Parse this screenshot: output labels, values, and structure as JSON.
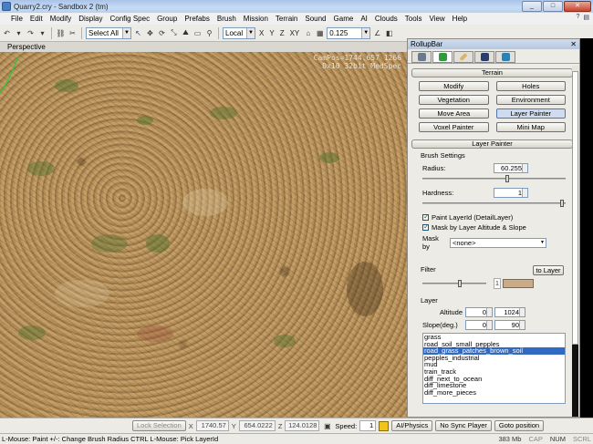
{
  "window": {
    "title": "Quarry2.cry - Sandbox 2 (tm)"
  },
  "menu": [
    "File",
    "Edit",
    "Modify",
    "Display",
    "Config Spec",
    "Group",
    "Prefabs",
    "Brush",
    "Mission",
    "Terrain",
    "Sound",
    "Game",
    "AI",
    "Clouds",
    "Tools",
    "View",
    "Help"
  ],
  "toolbar": {
    "select_mode": "Select All",
    "coord_system": "Local",
    "axes": [
      "X",
      "Y",
      "Z",
      "XY"
    ],
    "grid_value": "0.125"
  },
  "viewport": {
    "label": "Perspective",
    "cam_line1": "CamPos=1744.657 1266",
    "cam_line2": "Dx10 32bit MedSpec"
  },
  "rollup": {
    "title": "RollupBar",
    "terrain_header": "Terrain",
    "tools": [
      "Modify",
      "Holes",
      "Vegetation",
      "Environment",
      "Move Area",
      "Layer Painter",
      "Voxel Painter",
      "Mini Map"
    ],
    "layer_painter_header": "Layer Painter",
    "brush_settings_label": "Brush Settings",
    "radius_label": "Radius:",
    "radius_value": "60.255",
    "hardness_label": "Hardness:",
    "hardness_value": "1",
    "paint_layer_label": "Paint LayerId (DetailLayer)",
    "mask_altitude_label": "Mask by Layer Altitude & Slope",
    "mask_by_label": "Mask by",
    "mask_by_value": "<none>",
    "filter_label": "Filter",
    "to_layer_label": "to Layer",
    "filter_num": "1",
    "layer_label": "Layer",
    "altitude_label": "Altitude",
    "altitude_min": "0",
    "altitude_max": "1024",
    "slope_label": "Slope(deg.)",
    "slope_min": "0",
    "slope_max": "90",
    "layers": [
      "grass",
      "road_soil_small_pepples",
      "road_grass_patches_brown_soil",
      "pepples_industrial",
      "mud",
      "train_track",
      "diff_next_to_ocean",
      "diff_limestone",
      "diff_more_pieces"
    ],
    "selected_layer": "road_grass_patches_brown_soil"
  },
  "controls": {
    "lock_selection": "Lock Selection",
    "x_label": "X",
    "x_value": "1740.57",
    "y_label": "Y",
    "y_value": "654.0222",
    "z_label": "Z",
    "z_value": "124.0128",
    "speed_label": "Speed:",
    "speed_value": "1",
    "ai_physics": "AI/Physics",
    "no_sync_player": "No Sync Player",
    "goto_position": "Goto position"
  },
  "status": {
    "hint": "L-Mouse: Paint   +/-: Change Brush Radius   CTRL L-Mouse: Pick LayerId",
    "memory": "383 Mb",
    "cap": "CAP",
    "num": "NUM",
    "scrl": "SCRL"
  }
}
